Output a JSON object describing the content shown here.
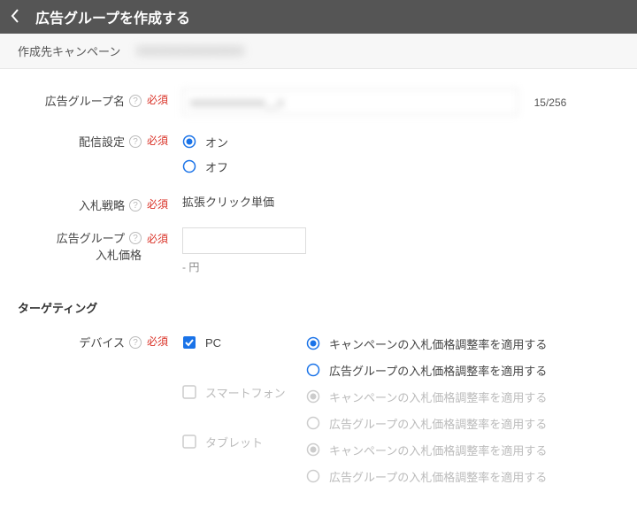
{
  "header": {
    "title": "広告グループを作成する"
  },
  "subheader": {
    "label": "作成先キャンペーン",
    "campaign": "XXXXXXXXXXXXXX"
  },
  "fields": {
    "adgroup_name": {
      "label": "広告グループ名",
      "required": "必須",
      "value": "xxxxxxxxxxxxx__x",
      "counter": "15/256"
    },
    "delivery": {
      "label": "配信設定",
      "required": "必須",
      "on": "オン",
      "off": "オフ",
      "selected": "on"
    },
    "bid_strategy": {
      "label": "入札戦略",
      "required": "必須",
      "value": "拡張クリック単価"
    },
    "bid_price": {
      "label_line1": "広告グループ",
      "label_line2": "入札価格",
      "required": "必須",
      "value": "",
      "note": "- 円"
    }
  },
  "targeting": {
    "section_title": "ターゲティング",
    "device": {
      "label": "デバイス",
      "required": "必須",
      "devices": [
        {
          "name": "PC",
          "checked": true,
          "enabled": true
        },
        {
          "name": "スマートフォン",
          "checked": false,
          "enabled": false
        },
        {
          "name": "タブレット",
          "checked": false,
          "enabled": false
        }
      ],
      "adj_options": {
        "campaign": "キャンペーンの入札価格調整率を適用する",
        "adgroup": "広告グループの入札価格調整率を適用する"
      },
      "selected_adj": [
        "campaign",
        "campaign",
        "campaign"
      ]
    }
  }
}
